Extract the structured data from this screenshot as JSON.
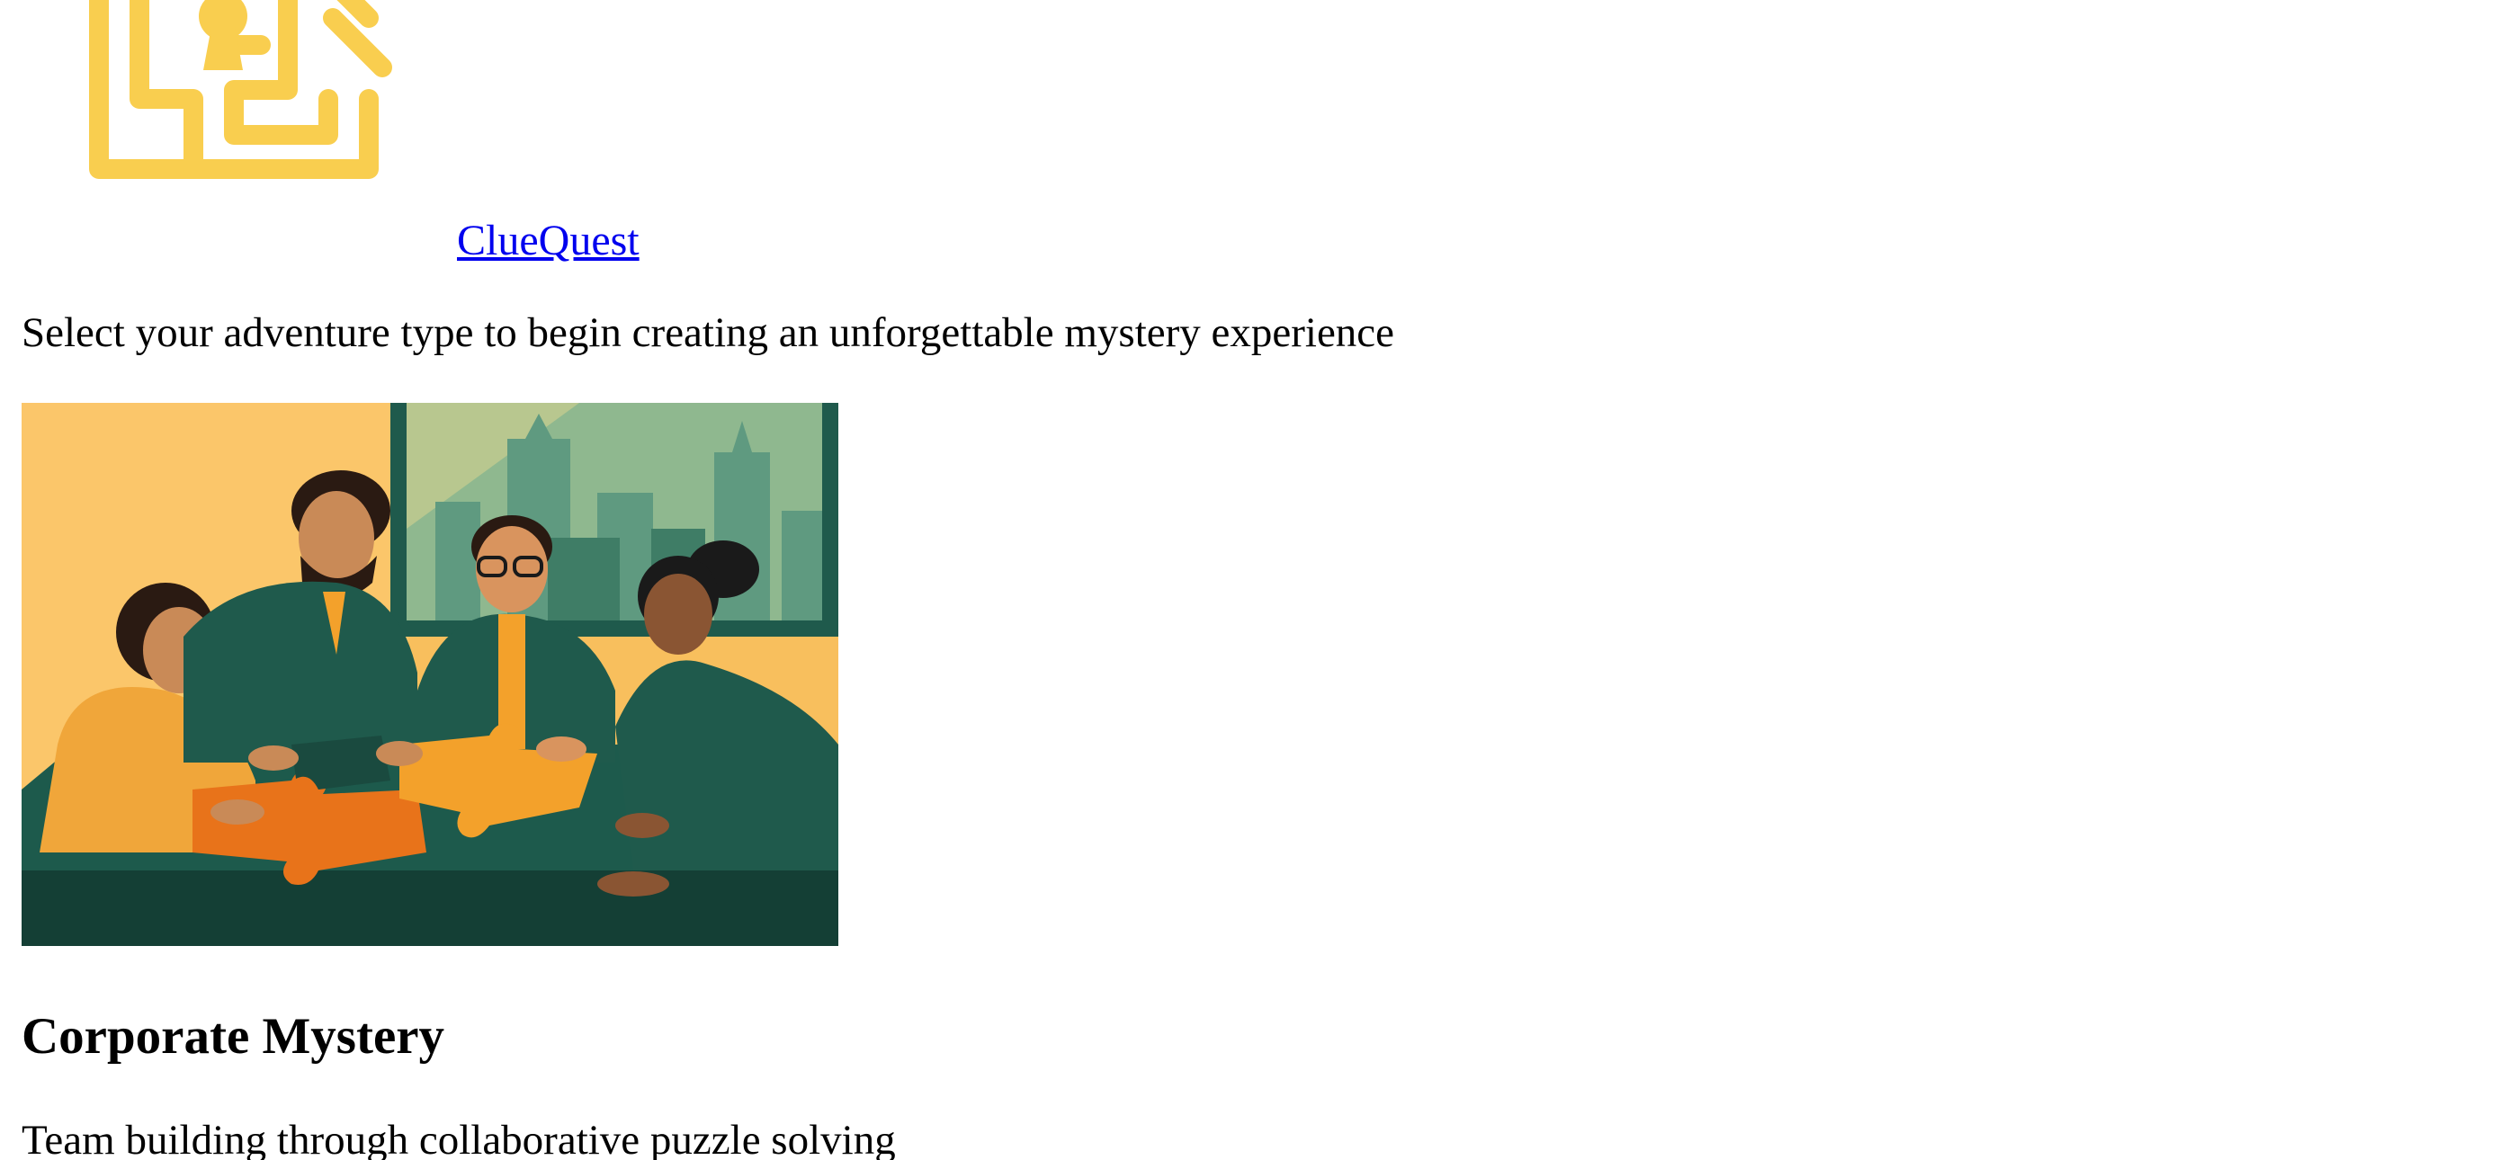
{
  "header": {
    "logo_icon": "maze-keyhole-house-icon",
    "brand_name": "ClueQuest"
  },
  "intro": {
    "tagline": "Select your adventure type to begin creating an unforgettable mystery experience"
  },
  "adventure_card": {
    "image_icon": "team-puzzle-illustration",
    "title": "Corporate Mystery",
    "description": "Team building through collaborative puzzle solving"
  },
  "colors": {
    "logo_yellow": "#f9ce4f",
    "link_blue": "#0000ee",
    "illustration_green": "#1f5a4c",
    "illustration_orange": "#f3a12b"
  }
}
